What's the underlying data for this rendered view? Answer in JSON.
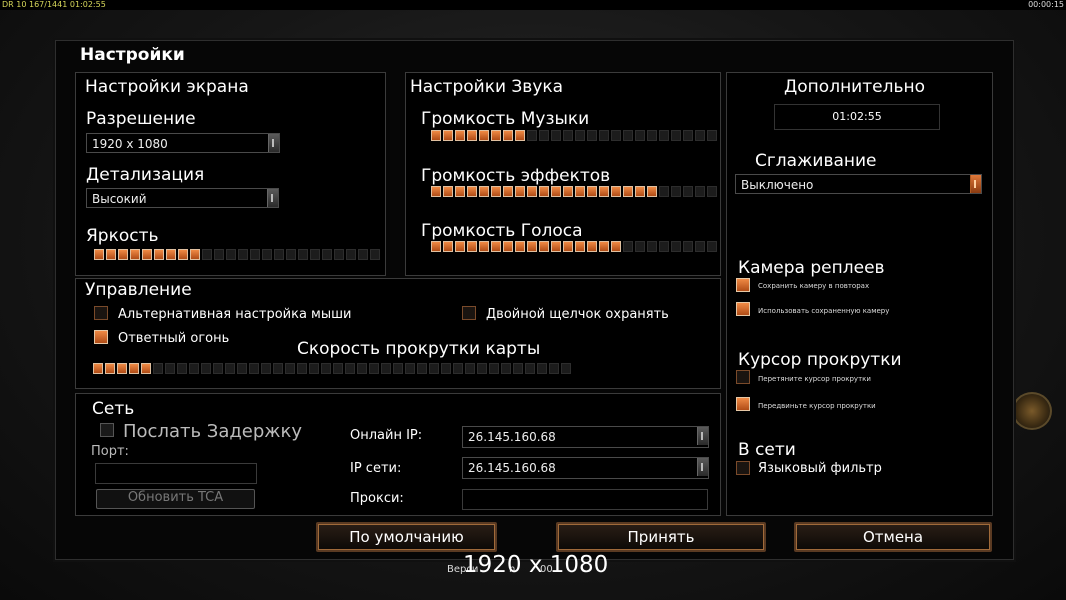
{
  "topbar": {
    "left_text": "DR 10 167/1441 01:02:55",
    "right_text": "00:00:15"
  },
  "title": "Настройки",
  "screen": {
    "title": "Настройки экрана",
    "resolution_label": "Разрешение",
    "resolution_value": "1920 x 1080",
    "detail_label": "Детализация",
    "detail_value": "Высокий",
    "brightness_label": "Яркость",
    "brightness_level": 9,
    "brightness_max": 24
  },
  "sound": {
    "title": "Настройки Звука",
    "music_label": "Громкость Музыки",
    "music_level": 8,
    "music_max": 24,
    "effects_label": "Громкость эффектов",
    "effects_level": 19,
    "effects_max": 24,
    "voice_label": "Громкость Голоса",
    "voice_level": 16,
    "voice_max": 24
  },
  "extra": {
    "title": "Дополнительно",
    "clock": "01:02:55",
    "antialias_label": "Сглаживание",
    "antialias_value": "Выключено",
    "replay_cam_label": "Камера реплеев",
    "replay_save": "Сохранить камеру в повторах",
    "replay_use": "Использовать сохраненную камеру",
    "scroll_cursor_label": "Курсор прокрутки",
    "scroll_drag": "Перетяните курсор прокрутки",
    "scroll_move": "Передвиньте курсор прокрутки",
    "online_label": "В сети",
    "lang_filter": "Языковый фильтр"
  },
  "controls": {
    "title": "Управление",
    "alt_mouse": "Альтернативная настройка мыши",
    "double_click": "Двойной щелчок охранять",
    "return_fire": "Ответный огонь",
    "scroll_speed_label": "Скорость прокрутки карты",
    "scroll_speed_level": 5,
    "scroll_speed_max": 40
  },
  "network": {
    "title": "Сеть",
    "send_delay": "Послать Задержку",
    "port_label": "Порт:",
    "port_value": "",
    "update_tca": "Обновить TCA",
    "online_ip_label": "Онлайн IP:",
    "online_ip_value": "26.145.160.68",
    "net_ip_label": "IP сети:",
    "net_ip_value": "26.145.160.68",
    "proxy_label": "Прокси:",
    "proxy_value": ""
  },
  "buttons": {
    "default": "По умолчанию",
    "apply": "Принять",
    "cancel": "Отмена"
  },
  "footer": {
    "version_prefix": "Верси",
    "version_middle": "n",
    "version_suffix": "00",
    "resolution_overlay": "1920 x 1080"
  },
  "colors": {
    "accent": "#e07a3a",
    "panel_bg": "#000000",
    "border": "#3b3b3b"
  }
}
